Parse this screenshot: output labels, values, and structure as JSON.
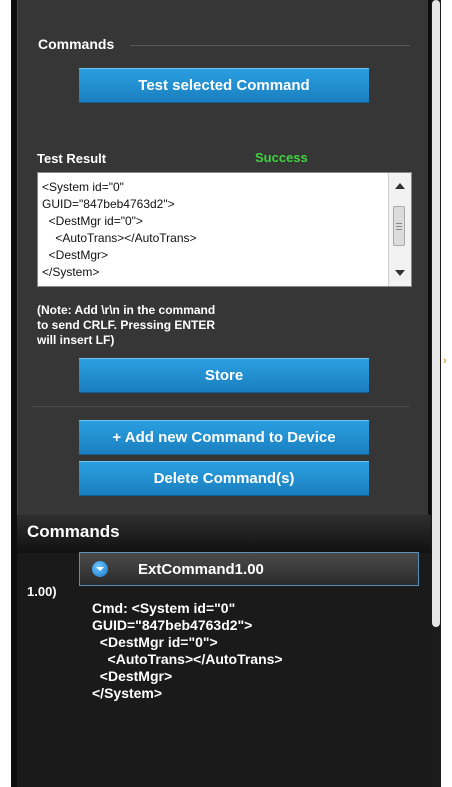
{
  "commands_section": {
    "title": "Commands"
  },
  "buttons": {
    "test": "Test selected Command",
    "store": "Store",
    "add": "+ Add new Command to Device",
    "delete": "Delete Command(s)"
  },
  "test_result": {
    "label": "Test Result",
    "status": "Success",
    "status_color": "#3fd23f",
    "text": "<System id=\"0\"\nGUID=\"847beb4763d2\">\n  <DestMgr id=\"0\">\n    <AutoTrans></AutoTrans>\n  <DestMgr>\n</System>"
  },
  "note": "(Note: Add \\r\\n in the command\nto send CRLF. Pressing ENTER\nwill insert LF)",
  "commands_list": {
    "title": "Commands",
    "items": [
      {
        "index": "1.00)",
        "name": "ExtCommand1.00",
        "detail": "Cmd: <System id=\"0\"\nGUID=\"847beb4763d2\">\n  <DestMgr id=\"0\">\n    <AutoTrans></AutoTrans>\n  <DestMgr>\n</System>"
      }
    ]
  },
  "colors": {
    "accent": "#1a8fd4",
    "panel": "#363636"
  }
}
